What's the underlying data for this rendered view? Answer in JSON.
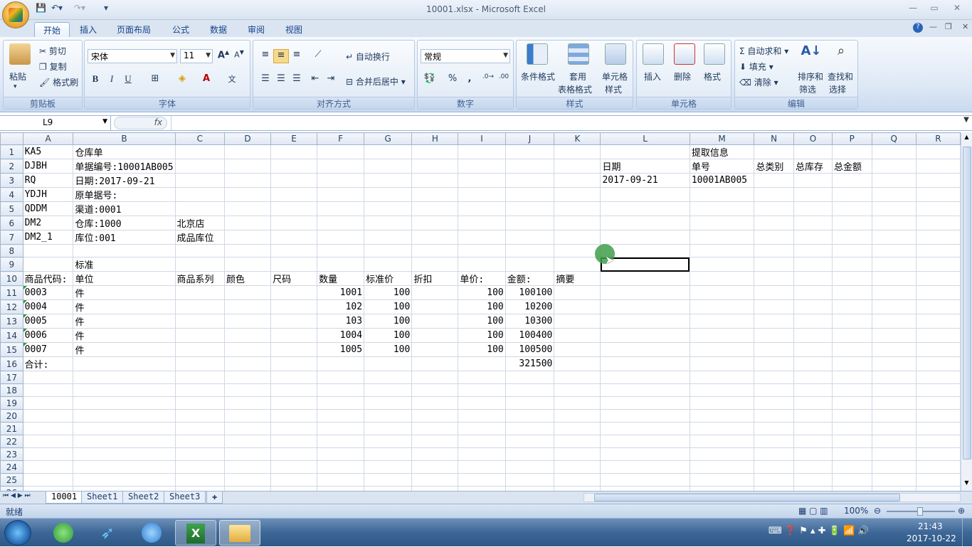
{
  "window": {
    "title": "10001.xlsx - Microsoft Excel"
  },
  "ribbon_tabs": [
    "开始",
    "插入",
    "页面布局",
    "公式",
    "数据",
    "审阅",
    "视图"
  ],
  "clipboard": {
    "paste": "粘贴",
    "cut": "剪切",
    "copy": "复制",
    "format_painter": "格式刷",
    "label": "剪贴板"
  },
  "font": {
    "name": "宋体",
    "size": "11",
    "bold": "B",
    "italic": "I",
    "underline": "U",
    "label": "字体"
  },
  "alignment": {
    "wrap": "自动换行",
    "merge": "合并后居中",
    "label": "对齐方式"
  },
  "number": {
    "format": "常规",
    "percent": "%",
    "comma": ",",
    "label": "数字"
  },
  "styles": {
    "conditional": "条件格式",
    "table_format_1": "套用",
    "table_format_2": "表格格式",
    "cell_style_1": "单元格",
    "cell_style_2": "样式",
    "label": "样式"
  },
  "cells": {
    "insert": "插入",
    "delete": "删除",
    "format": "格式",
    "label": "单元格"
  },
  "editing": {
    "autosum": "自动求和",
    "fill": "填充",
    "clear": "清除",
    "sort_1": "排序和",
    "sort_2": "筛选",
    "find_1": "查找和",
    "find_2": "选择",
    "label": "编辑"
  },
  "formula_bar": {
    "name_box": "L9",
    "fx": "fx",
    "content": ""
  },
  "columns": [
    "A",
    "B",
    "C",
    "D",
    "E",
    "F",
    "G",
    "H",
    "I",
    "J",
    "K",
    "L",
    "M",
    "N",
    "O",
    "P",
    "Q",
    "R"
  ],
  "rows": [
    [
      "KA5",
      "仓库单",
      "",
      "",
      "",
      "",
      "",
      "",
      "",
      "",
      "",
      "",
      "提取信息",
      "",
      "",
      "",
      "",
      ""
    ],
    [
      "DJBH",
      "单据编号:10001AB005",
      "",
      "",
      "",
      "",
      "",
      "",
      "",
      "",
      "",
      "日期",
      "单号",
      "总类别",
      "总库存",
      "总金额",
      "",
      ""
    ],
    [
      "RQ",
      "日期:2017-09-21",
      "",
      "",
      "",
      "",
      "",
      "",
      "",
      "",
      "",
      "2017-09-21",
      "10001AB005",
      "",
      "",
      "",
      "",
      ""
    ],
    [
      "YDJH",
      "原单据号:",
      "",
      "",
      "",
      "",
      "",
      "",
      "",
      "",
      "",
      "",
      "",
      "",
      "",
      "",
      "",
      ""
    ],
    [
      "QDDM",
      "渠道:0001",
      "",
      "",
      "",
      "",
      "",
      "",
      "",
      "",
      "",
      "",
      "",
      "",
      "",
      "",
      "",
      ""
    ],
    [
      "DM2",
      "仓库:1000",
      "北京店",
      "",
      "",
      "",
      "",
      "",
      "",
      "",
      "",
      "",
      "",
      "",
      "",
      "",
      "",
      ""
    ],
    [
      "DM2_1",
      "库位:001",
      "成品库位",
      "",
      "",
      "",
      "",
      "",
      "",
      "",
      "",
      "",
      "",
      "",
      "",
      "",
      "",
      ""
    ],
    [
      "",
      "",
      "",
      "",
      "",
      "",
      "",
      "",
      "",
      "",
      "",
      "",
      "",
      "",
      "",
      "",
      "",
      ""
    ],
    [
      "",
      "标准",
      "",
      "",
      "",
      "",
      "",
      "",
      "",
      "",
      "",
      "",
      "",
      "",
      "",
      "",
      "",
      ""
    ],
    [
      "商品代码:",
      "单位",
      "商品系列",
      "颜色",
      "尺码",
      "数量",
      "标准价",
      "折扣",
      "单价:",
      "金额:",
      "摘要",
      "",
      "",
      "",
      "",
      "",
      "",
      ""
    ],
    [
      "0003",
      "件",
      "",
      "",
      "",
      "1001",
      "100",
      "",
      "100",
      "100100",
      "",
      "",
      "",
      "",
      "",
      "",
      "",
      ""
    ],
    [
      "0004",
      "件",
      "",
      "",
      "",
      "102",
      "100",
      "",
      "100",
      "10200",
      "",
      "",
      "",
      "",
      "",
      "",
      "",
      ""
    ],
    [
      "0005",
      "件",
      "",
      "",
      "",
      "103",
      "100",
      "",
      "100",
      "10300",
      "",
      "",
      "",
      "",
      "",
      "",
      "",
      ""
    ],
    [
      "0006",
      "件",
      "",
      "",
      "",
      "1004",
      "100",
      "",
      "100",
      "100400",
      "",
      "",
      "",
      "",
      "",
      "",
      "",
      ""
    ],
    [
      "0007",
      "件",
      "",
      "",
      "",
      "1005",
      "100",
      "",
      "100",
      "100500",
      "",
      "",
      "",
      "",
      "",
      "",
      "",
      ""
    ],
    [
      "合计:",
      "",
      "",
      "",
      "",
      "",
      "",
      "",
      "",
      "321500",
      "",
      "",
      "",
      "",
      "",
      "",
      "",
      ""
    ],
    [
      "",
      "",
      "",
      "",
      "",
      "",
      "",
      "",
      "",
      "",
      "",
      "",
      "",
      "",
      "",
      "",
      "",
      ""
    ],
    [
      "",
      "",
      "",
      "",
      "",
      "",
      "",
      "",
      "",
      "",
      "",
      "",
      "",
      "",
      "",
      "",
      "",
      ""
    ],
    [
      "",
      "",
      "",
      "",
      "",
      "",
      "",
      "",
      "",
      "",
      "",
      "",
      "",
      "",
      "",
      "",
      "",
      ""
    ],
    [
      "",
      "",
      "",
      "",
      "",
      "",
      "",
      "",
      "",
      "",
      "",
      "",
      "",
      "",
      "",
      "",
      "",
      ""
    ],
    [
      "",
      "",
      "",
      "",
      "",
      "",
      "",
      "",
      "",
      "",
      "",
      "",
      "",
      "",
      "",
      "",
      "",
      ""
    ],
    [
      "",
      "",
      "",
      "",
      "",
      "",
      "",
      "",
      "",
      "",
      "",
      "",
      "",
      "",
      "",
      "",
      "",
      ""
    ],
    [
      "",
      "",
      "",
      "",
      "",
      "",
      "",
      "",
      "",
      "",
      "",
      "",
      "",
      "",
      "",
      "",
      "",
      ""
    ],
    [
      "",
      "",
      "",
      "",
      "",
      "",
      "",
      "",
      "",
      "",
      "",
      "",
      "",
      "",
      "",
      "",
      "",
      ""
    ],
    [
      "",
      "",
      "",
      "",
      "",
      "",
      "",
      "",
      "",
      "",
      "",
      "",
      "",
      "",
      "",
      "",
      "",
      ""
    ],
    [
      "",
      "",
      "",
      "",
      "",
      "",
      "",
      "",
      "",
      "",
      "",
      "",
      "",
      "",
      "",
      "",
      "",
      ""
    ],
    [
      "",
      "",
      "",
      "",
      "",
      "",
      "",
      "",
      "",
      "",
      "",
      "",
      "",
      "",
      "",
      "",
      "",
      ""
    ]
  ],
  "numeric_rows_start": 11,
  "sheets": [
    "10001",
    "Sheet1",
    "Sheet2",
    "Sheet3"
  ],
  "active_sheet": "10001",
  "status": {
    "ready": "就绪",
    "zoom": "100%"
  },
  "clock": {
    "time": "21:43",
    "date": "2017-10-22"
  }
}
